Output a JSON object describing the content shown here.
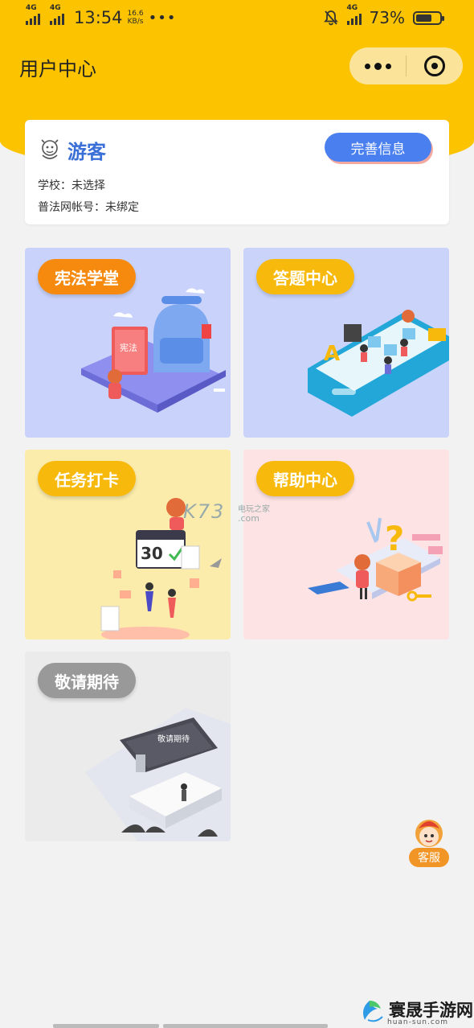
{
  "status_bar": {
    "signal1": "4G",
    "signal2": "4G",
    "time": "13:54",
    "speed_value": "16.6",
    "speed_unit": "KB/s",
    "more": "•••",
    "network_right": "4G",
    "battery_text": "73%",
    "battery_level": 0.73
  },
  "header": {
    "title": "用户中心"
  },
  "user": {
    "name": "游客",
    "complete_button": "完善信息",
    "school_label": "学校：",
    "school_value": "未选择",
    "account_label": "普法网帐号：",
    "account_value": "未绑定"
  },
  "tiles": [
    {
      "label": "宪法学堂",
      "bg": "#c9d2fa",
      "pill": "#f58a0e"
    },
    {
      "label": "答题中心",
      "bg": "#cad4fa",
      "pill": "#f7b90c"
    },
    {
      "label": "任务打卡",
      "bg": "#fcecab",
      "pill": "#f7b90c"
    },
    {
      "label": "帮助中心",
      "bg": "#fde3e4",
      "pill": "#f7b90c"
    },
    {
      "label": "敬请期待",
      "bg": "#ebebeb",
      "pill": "#999999"
    }
  ],
  "illustration_text": {
    "book": "宪法",
    "calendar": "30",
    "screen": "敬请期待"
  },
  "customer_service": {
    "label": "客服"
  },
  "watermark": {
    "k73": "K73",
    "k73_cn": "电玩之家",
    "k73_domain": ".com",
    "site": "寰晟手游网",
    "site_domain": "huan-sun.com"
  }
}
